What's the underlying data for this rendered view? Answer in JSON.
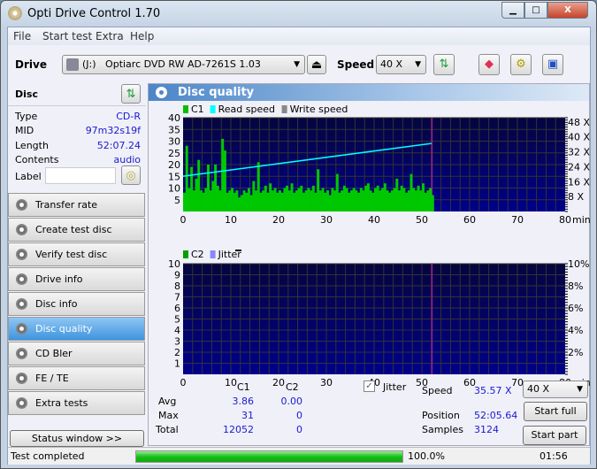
{
  "window": {
    "title": "Opti Drive Control 1.70",
    "minimize": "▁",
    "maximize": "□",
    "close": "X"
  },
  "menu": [
    "File",
    "Start test",
    "Extra",
    "Help"
  ],
  "toolbar": {
    "drive_label": "Drive",
    "drive_letter": "(J:)",
    "drive_name": "Optiarc DVD RW AD-7261S 1.03",
    "speed_label": "Speed",
    "speed_value": "40 X"
  },
  "disc": {
    "header": "Disc",
    "type_label": "Type",
    "type": "CD-R",
    "mid_label": "MID",
    "mid": "97m32s19f",
    "length_label": "Length",
    "length": "52:07.24",
    "contents_label": "Contents",
    "contents": "audio",
    "label_label": "Label",
    "label_value": ""
  },
  "nav": [
    "Transfer rate",
    "Create test disc",
    "Verify test disc",
    "Drive info",
    "Disc info",
    "Disc quality",
    "CD Bler",
    "FE / TE",
    "Extra tests"
  ],
  "nav_selected": "Disc quality",
  "status_window": "Status window >>",
  "panel_title": "Disc quality",
  "chart_data": [
    {
      "type": "bar",
      "legend": [
        "C1",
        "Read speed",
        "Write speed"
      ],
      "colors": {
        "C1": "#00c000",
        "Read speed": "#00ffff",
        "Write speed": "#888888"
      },
      "xlim": [
        0,
        80
      ],
      "xlabel": "min",
      "xticks": [
        0,
        10,
        20,
        30,
        40,
        50,
        60,
        70,
        80
      ],
      "ylim": [
        0,
        40
      ],
      "yticks": [
        5,
        10,
        15,
        20,
        25,
        30,
        35,
        40
      ],
      "y2ticks": [
        "8 X",
        "16 X",
        "24 X",
        "32 X",
        "40 X",
        "48 X"
      ],
      "y2lim": [
        0,
        50.3
      ],
      "end_marker_min": 52.1,
      "c1_step_min": 0.5,
      "c1": [
        8,
        28,
        10,
        19,
        9,
        14,
        22,
        9,
        8,
        10,
        20,
        9,
        13,
        20,
        11,
        9,
        31,
        26,
        8,
        9,
        10,
        8,
        9,
        6,
        7,
        9,
        8,
        10,
        7,
        13,
        9,
        21,
        8,
        9,
        11,
        8,
        12,
        9,
        10,
        8,
        9,
        8,
        10,
        11,
        9,
        12,
        8,
        9,
        10,
        11,
        8,
        9,
        10,
        9,
        11,
        8,
        18,
        9,
        10,
        8,
        9,
        7,
        10,
        9,
        16,
        8,
        9,
        11,
        10,
        8,
        9,
        10,
        9,
        8,
        10,
        9,
        11,
        12,
        9,
        8,
        10,
        11,
        9,
        10,
        12,
        9,
        8,
        9,
        10,
        14,
        9,
        11,
        10,
        8,
        9,
        16,
        10,
        9,
        11,
        9,
        12,
        8,
        9,
        10,
        7
      ],
      "read_speed": {
        "x": [
          0,
          52
        ],
        "y": [
          18.9,
          36.5
        ]
      }
    },
    {
      "type": "bar",
      "legend": [
        "C2",
        "Jitter"
      ],
      "colors": {
        "C2": "#00a000",
        "Jitter": "#8888ff"
      },
      "xlim": [
        0,
        80
      ],
      "xlabel": "min",
      "xticks": [
        0,
        10,
        20,
        30,
        40,
        50,
        60,
        70,
        80
      ],
      "ylim": [
        0,
        10
      ],
      "yticks": [
        1,
        2,
        3,
        4,
        5,
        6,
        7,
        8,
        9,
        10
      ],
      "y2ticks": [
        "2%",
        "4%",
        "6%",
        "8%",
        "10%"
      ],
      "c2": [],
      "end_marker_min": 52.1
    }
  ],
  "stats": {
    "col_c1": "C1",
    "col_c2": "C2",
    "avg_label": "Avg",
    "max_label": "Max",
    "total_label": "Total",
    "avg_c1": "3.86",
    "avg_c2": "0.00",
    "max_c1": "31",
    "max_c2": "0",
    "total_c1": "12052",
    "total_c2": "0"
  },
  "jitter": {
    "label": "Jitter",
    "checked": true
  },
  "info": {
    "speed_label": "Speed",
    "speed": "35.57 X",
    "position_label": "Position",
    "position": "52:05.64",
    "samples_label": "Samples",
    "samples": "3124"
  },
  "controls": {
    "speed": "40 X",
    "start_full": "Start full",
    "start_part": "Start part"
  },
  "statusbar": {
    "text": "Test completed",
    "progress": 100,
    "progress_text": "100.0%",
    "time": "01:56"
  }
}
